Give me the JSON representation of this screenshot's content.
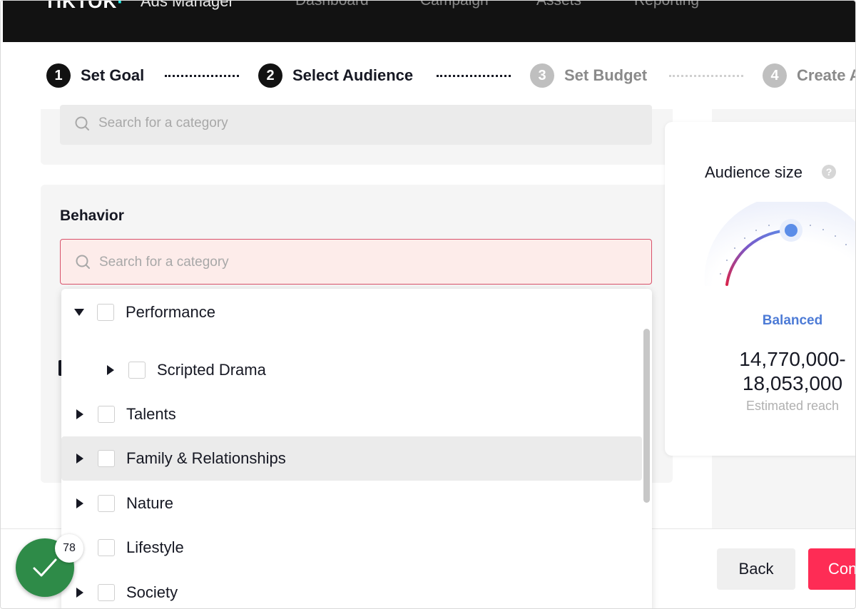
{
  "brand": {
    "logo": "TIKTOK",
    "product": "Ads Manager"
  },
  "nav": {
    "items": [
      "Dashboard",
      "Campaign",
      "Assets",
      "Reporting"
    ]
  },
  "stepper": {
    "steps": [
      {
        "num": "1",
        "label": "Set Goal"
      },
      {
        "num": "2",
        "label": "Select Audience"
      },
      {
        "num": "3",
        "label": "Set Budget"
      },
      {
        "num": "4",
        "label": "Create Ad"
      }
    ]
  },
  "interests": {
    "search_placeholder": "Search for a category"
  },
  "behavior": {
    "title": "Behavior",
    "search_placeholder": "Search for a category"
  },
  "dropdown": {
    "items": [
      {
        "label": "Performance",
        "expanded": true
      },
      {
        "label": "Scripted Drama"
      },
      {
        "label": "Talents"
      },
      {
        "label": "Family & Relationships",
        "highlighted": true
      },
      {
        "label": "Nature"
      },
      {
        "label": "Lifestyle"
      },
      {
        "label": "Society"
      }
    ]
  },
  "audience": {
    "title": "Audience size",
    "help_glyph": "?",
    "status": "Balanced",
    "reach_line1": "14,770,000-",
    "reach_line2": "18,053,000",
    "reach_label": "Estimated reach",
    "gauge_level": 0.5
  },
  "footer": {
    "back_label": "Back",
    "continue_label": "Continue"
  },
  "badge": {
    "count": "78"
  },
  "colors": {
    "accent": "#fe2c55",
    "balanced": "#4d7bd6",
    "success": "#2e8b48"
  }
}
